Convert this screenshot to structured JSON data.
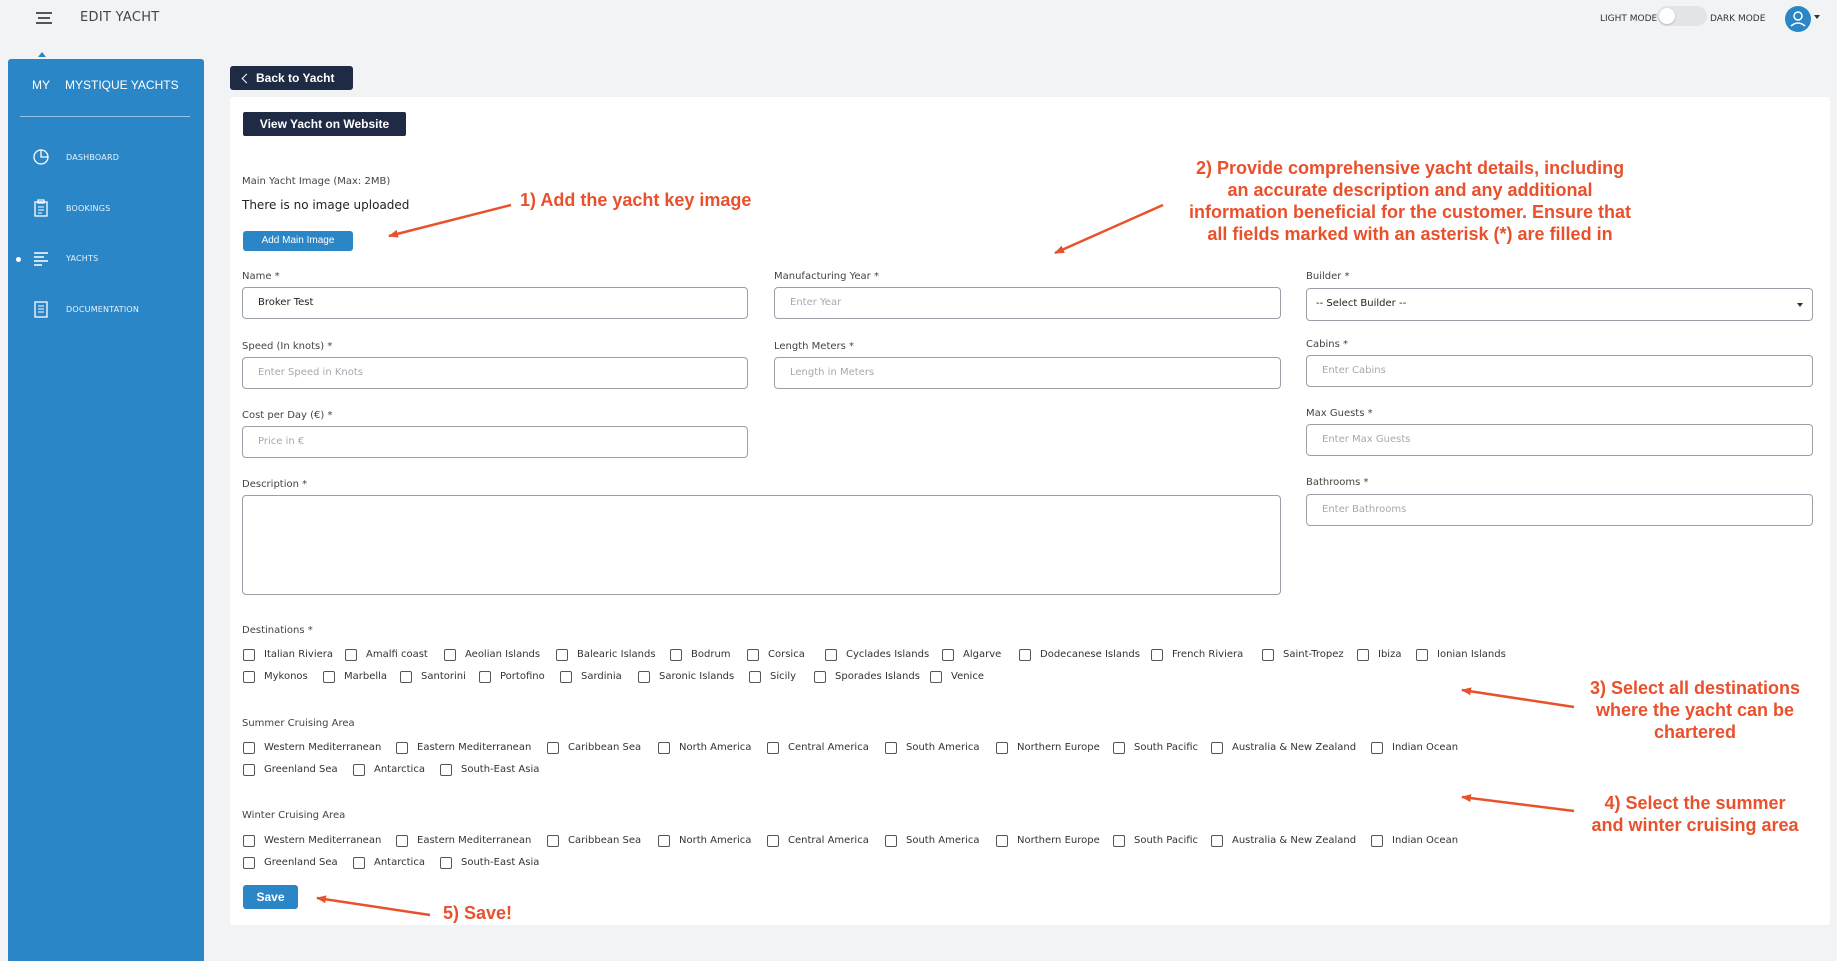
{
  "header": {
    "title": "EDIT YACHT",
    "light_mode": "LIGHT MODE",
    "dark_mode": "DARK MODE",
    "dark_mode_enabled": false
  },
  "sidebar": {
    "brand_short": "MY",
    "brand_name": "MYSTIQUE YACHTS",
    "items": [
      {
        "label": "DASHBOARD",
        "icon": "pie-chart-icon"
      },
      {
        "label": "BOOKINGS",
        "icon": "clipboard-icon"
      },
      {
        "label": "YACHTS",
        "icon": "list-icon",
        "active": true
      },
      {
        "label": "DOCUMENTATION",
        "icon": "document-icon"
      }
    ]
  },
  "actions": {
    "back": "Back to Yacht",
    "view_website": "View Yacht on Website",
    "add_image": "Add Main Image",
    "save": "Save"
  },
  "image": {
    "label": "Main Yacht Image (Max: 2MB)",
    "status": "There is no image uploaded"
  },
  "fields": {
    "name": {
      "label": "Name *",
      "value": "Broker Test"
    },
    "year": {
      "label": "Manufacturing Year *",
      "placeholder": "Enter Year"
    },
    "builder": {
      "label": "Builder *",
      "value": "-- Select Builder --"
    },
    "speed": {
      "label": "Speed (In knots) *",
      "placeholder": "Enter Speed in Knots"
    },
    "length": {
      "label": "Length Meters *",
      "placeholder": "Length in Meters"
    },
    "cabins": {
      "label": "Cabins *",
      "placeholder": "Enter Cabins"
    },
    "cost": {
      "label": "Cost per Day (€) *",
      "placeholder": "Price in €"
    },
    "guests": {
      "label": "Max Guests *",
      "placeholder": "Enter Max Guests"
    },
    "description": {
      "label": "Description *"
    },
    "bathrooms": {
      "label": "Bathrooms *",
      "placeholder": "Enter Bathrooms"
    }
  },
  "destinations": {
    "label": "Destinations *",
    "row1": [
      "Italian Riviera",
      "Amalfi coast",
      "Aeolian Islands",
      "Balearic Islands",
      "Bodrum",
      "Corsica",
      "Cyclades Islands",
      "Algarve",
      "Dodecanese Islands",
      "French Riviera",
      "Saint-Tropez",
      "Ibiza",
      "Ionian Islands"
    ],
    "row2": [
      "Mykonos",
      "Marbella",
      "Santorini",
      "Portofino",
      "Sardinia",
      "Saronic Islands",
      "Sicily",
      "Sporades Islands",
      "Venice"
    ]
  },
  "summer": {
    "label": "Summer Cruising Area",
    "row1": [
      "Western Mediterranean",
      "Eastern Mediterranean",
      "Caribbean Sea",
      "North America",
      "Central America",
      "South America",
      "Northern Europe",
      "South Pacific",
      "Australia & New Zealand",
      "Indian Ocean"
    ],
    "row2": [
      "Greenland Sea",
      "Antarctica",
      "South-East Asia"
    ]
  },
  "winter": {
    "label": "Winter Cruising Area",
    "row1": [
      "Western Mediterranean",
      "Eastern Mediterranean",
      "Caribbean Sea",
      "North America",
      "Central America",
      "South America",
      "Northern Europe",
      "South Pacific",
      "Australia & New Zealand",
      "Indian Ocean"
    ],
    "row2": [
      "Greenland Sea",
      "Antarctica",
      "South-East Asia"
    ]
  },
  "annotations": {
    "a1": "1) Add the yacht key image",
    "a2": [
      "2) Provide comprehensive yacht details, including",
      "an accurate description and any additional",
      "information beneficial for the customer. Ensure that",
      "all fields marked with an asterisk (*) are filled in"
    ],
    "a3": [
      "3) Select all destinations",
      "where the yacht can be",
      "chartered"
    ],
    "a4": [
      "4) Select the summer",
      "and winter cruising area"
    ],
    "a5": "5) Save!"
  },
  "colors": {
    "sidebar": "#2a86c6",
    "dark_button": "#1f2a44",
    "annotation": "#e8512c"
  }
}
